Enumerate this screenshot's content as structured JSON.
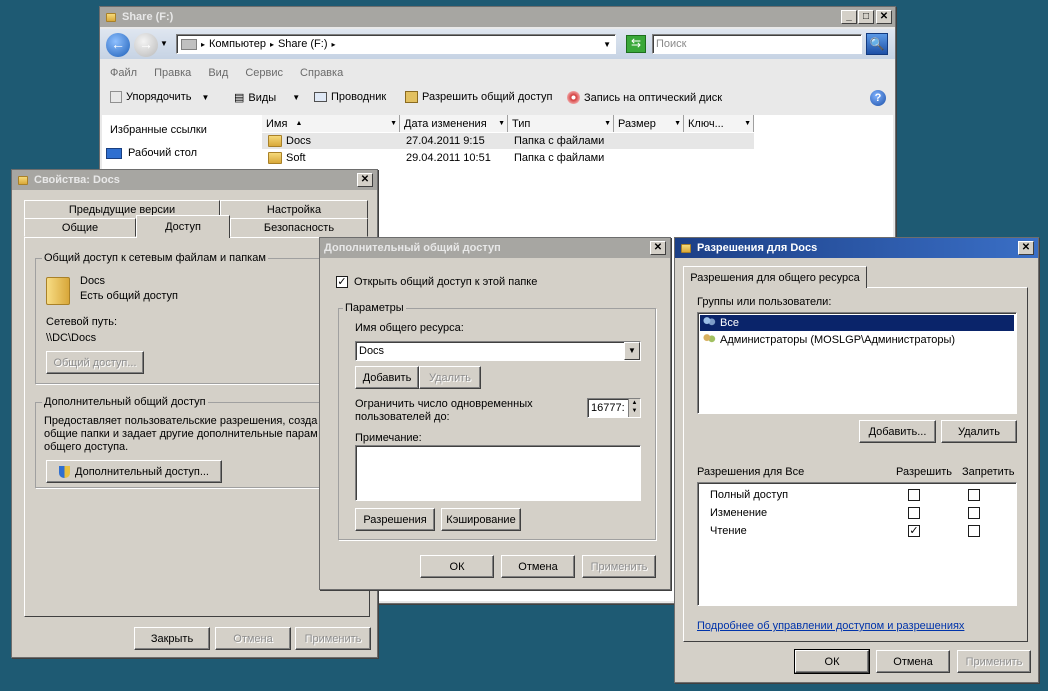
{
  "explorer": {
    "title": "Share (F:)",
    "address": [
      "Компьютер",
      "Share (F:)"
    ],
    "search_placeholder": "Поиск",
    "menu": [
      "Файл",
      "Правка",
      "Вид",
      "Сервис",
      "Справка"
    ],
    "toolbar": {
      "organize": "Упорядочить",
      "views": "Виды",
      "explorer": "Проводник",
      "share": "Разрешить общий доступ",
      "burn": "Запись на оптический диск"
    },
    "nav": [
      "Избранные ссылки",
      "Рабочий стол"
    ],
    "columns": [
      "Имя",
      "Дата изменения",
      "Тип",
      "Размер",
      "Ключ..."
    ],
    "files": [
      {
        "name": "Docs",
        "date": "27.04.2011 9:15",
        "type": "Папка с файлами"
      },
      {
        "name": "Soft",
        "date": "29.04.2011 10:51",
        "type": "Папка с файлами"
      }
    ]
  },
  "props": {
    "title": "Свойства: Docs",
    "tabs_back": [
      "Предыдущие версии",
      "Настройка"
    ],
    "tabs_front": [
      "Общие",
      "Доступ",
      "Безопасность"
    ],
    "group1_title": "Общий доступ к сетевым файлам и папкам",
    "folder_name": "Docs",
    "folder_status": "Есть общий доступ",
    "net_path_label": "Сетевой путь:",
    "net_path": "\\\\DC\\Docs",
    "share_btn": "Общий доступ...",
    "group2_title": "Дополнительный общий доступ",
    "group2_text1": "Предоставляет пользовательские разрешения, созда",
    "group2_text2": "общие папки и задает другие дополнительные парам",
    "group2_text3": "общего доступа.",
    "adv_btn": "Дополнительный доступ...",
    "close": "Закрыть",
    "cancel": "Отмена",
    "apply": "Применить"
  },
  "adv": {
    "title": "Дополнительный общий доступ",
    "share_check": "Открыть общий доступ к этой папке",
    "params": "Параметры",
    "share_name_label": "Имя общего ресурса:",
    "share_name": "Docs",
    "add": "Добавить",
    "remove": "Удалить",
    "limit_label1": "Ограничить число одновременных",
    "limit_label2": "пользователей до:",
    "limit_value": "16777:",
    "note_label": "Примечание:",
    "permissions": "Разрешения",
    "caching": "Кэширование",
    "ok": "ОК",
    "cancel": "Отмена",
    "apply": "Применить"
  },
  "perm": {
    "title": "Разрешения для Docs",
    "tab": "Разрешения для общего ресурса",
    "groups_label": "Группы или пользователи:",
    "users": [
      "Все",
      "Администраторы (MOSLGP\\Администраторы)"
    ],
    "add": "Добавить...",
    "remove": "Удалить",
    "perm_label": "Разрешения для Все",
    "allow": "Разрешить",
    "deny": "Запретить",
    "rows": [
      {
        "name": "Полный доступ",
        "allow": false,
        "deny": false
      },
      {
        "name": "Изменение",
        "allow": false,
        "deny": false
      },
      {
        "name": "Чтение",
        "allow": true,
        "deny": false
      }
    ],
    "link": "Подробнее об управлении доступом и разрешениях",
    "ok": "ОК",
    "cancel": "Отмена",
    "apply": "Применить"
  }
}
